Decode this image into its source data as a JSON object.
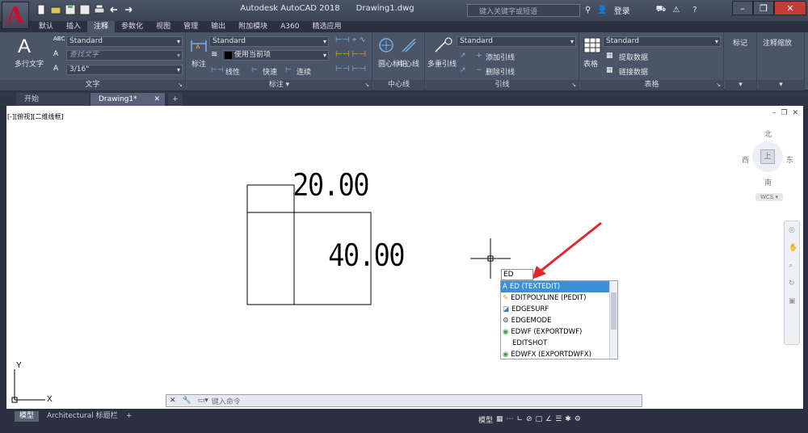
{
  "title": {
    "app": "Autodesk AutoCAD 2018",
    "file": "Drawing1.dwg",
    "search_placeholder": "键入关键字或短语",
    "login": "登录"
  },
  "ribbon_tabs": [
    "默认",
    "插入",
    "注释",
    "参数化",
    "视图",
    "管理",
    "输出",
    "附加模块",
    "A360",
    "精选应用"
  ],
  "ribbon": {
    "text_panel": {
      "multiline": "多行文字",
      "style": "Standard",
      "find_placeholder": "查找文字",
      "height": "3/16\"",
      "footer": "文字"
    },
    "dim_panel": {
      "dimension": "标注",
      "style": "Standard",
      "layer": "使用当前项",
      "linear": "线性",
      "quick": "快速",
      "continue": "连续",
      "footer": "标注"
    },
    "center_panel": {
      "center_mark": "圆心标记",
      "centerline": "中心线",
      "footer": "中心线"
    },
    "leader_panel": {
      "multileader": "多重引线",
      "style": "Standard",
      "add": "添加引线",
      "remove": "删除引线",
      "footer": "引线"
    },
    "table_panel": {
      "table": "表格",
      "style": "Standard",
      "extract": "提取数据",
      "link": "链接数据",
      "footer": "表格"
    },
    "markup": "标记",
    "annot_scale": "注释缩放"
  },
  "doc_tabs": [
    "开始",
    "Drawing1*"
  ],
  "viewport_label": "[-][俯视][二维线框]",
  "viewcube": {
    "north": "北",
    "south": "南",
    "east": "东",
    "west": "西",
    "top": "上",
    "wcs": "WCS"
  },
  "drawing": {
    "dim1": "20.00",
    "dim2": "40.00"
  },
  "command": {
    "input": "ED",
    "placeholder": "键入命令"
  },
  "autocomplete": [
    "ED (TEXTEDIT)",
    "EDITPOLYLINE (PEDIT)",
    "EDGESURF",
    "EDGEMODE",
    "EDWF (EXPORTDWF)",
    "EDITSHOT",
    "EDWFX (EXPORTDWFX)"
  ],
  "layout_tabs": [
    "模型",
    "Architectural 标题栏"
  ],
  "status": {
    "model": "模型"
  },
  "colors": {
    "arrow": "#e3252b",
    "selection": "#3d8fd6",
    "ribbon": "#4b5568"
  }
}
